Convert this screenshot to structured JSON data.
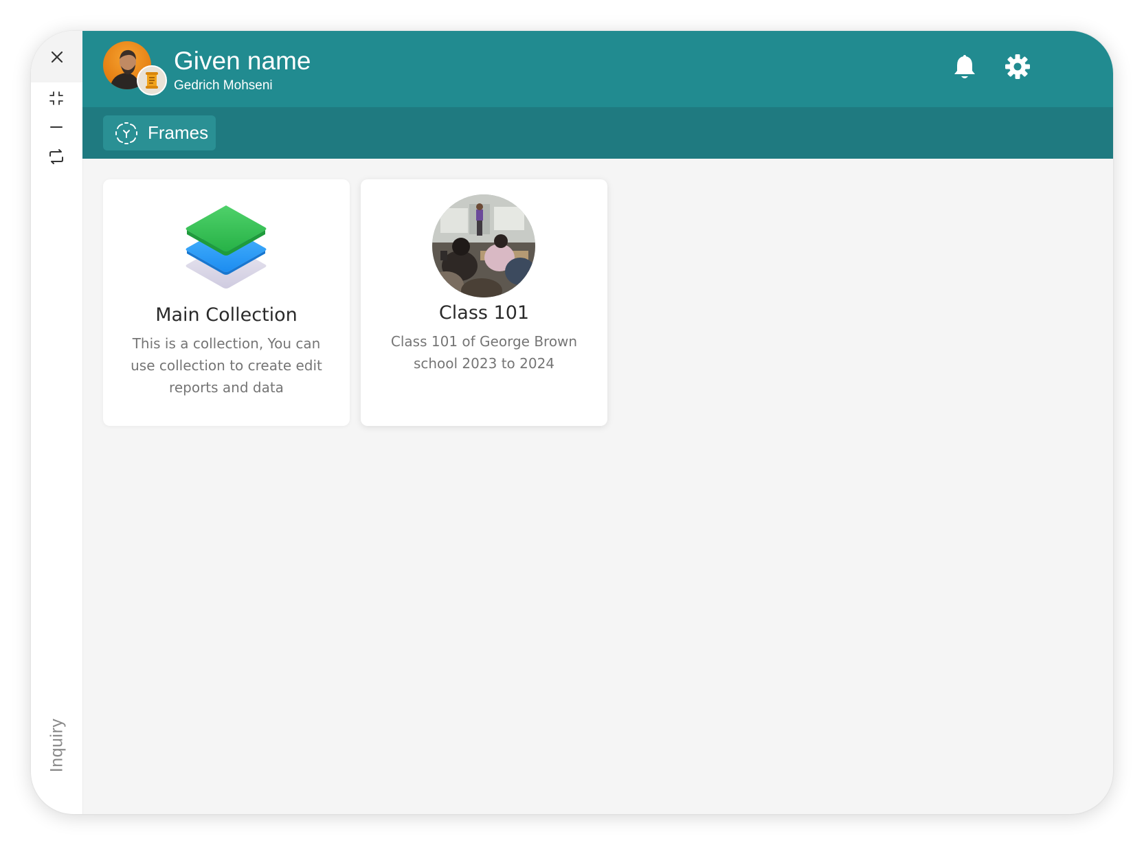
{
  "sidebar": {
    "label": "Inquiry",
    "icons": [
      "close-icon",
      "collapse-icon",
      "minimize-icon",
      "switch-icon"
    ]
  },
  "header": {
    "given_name": "Given name",
    "user_name": "Gedrich Mohseni",
    "icons": [
      "bell-icon",
      "gear-icon"
    ],
    "accent": "#218b90"
  },
  "frames_bar": {
    "label": "Frames",
    "icon": "frame-scan-icon",
    "background": "#1f7a80"
  },
  "cards": [
    {
      "title": "Main Collection",
      "description": "This is a collection, You can use collection to create edit reports and data",
      "icon": "layers-icon"
    },
    {
      "title": "Class 101",
      "description": "Class 101 of George Brown school 2023 to 2024",
      "icon": "classroom-photo"
    }
  ]
}
